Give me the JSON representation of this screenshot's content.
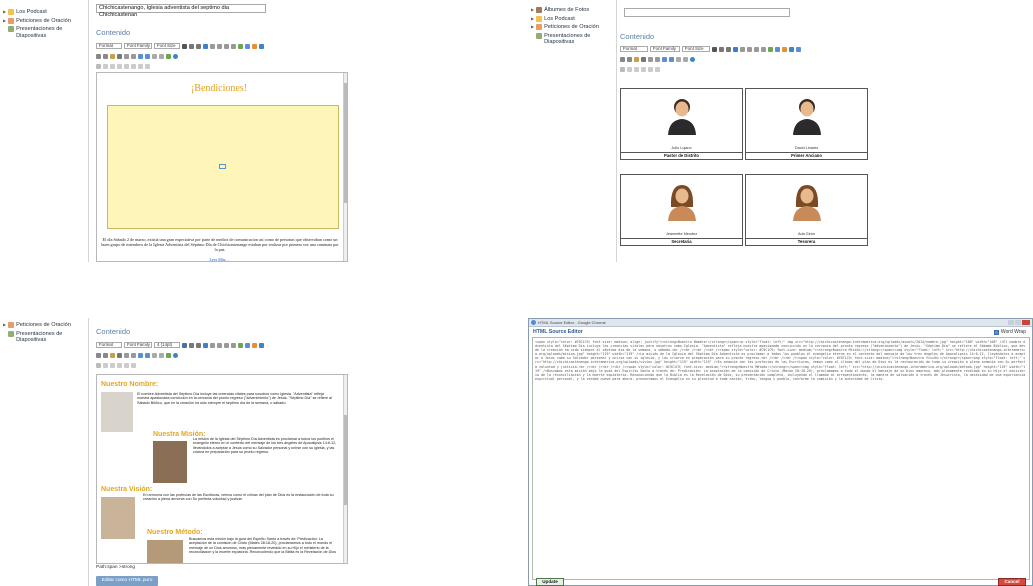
{
  "panel1": {
    "sidebar": [
      {
        "label": "Los Podcast",
        "icon": "podcast-icon"
      },
      {
        "label": "Peticiones de Oración",
        "icon": "prayer-icon"
      },
      {
        "label": "Presentaciones de Diapositivas",
        "icon": "slides-icon"
      }
    ],
    "title_value": "Chichicastenango, Iglesia adventista del septimo dia Chichicastenan",
    "section_label": "Contenido",
    "toolbar": {
      "format": "Format",
      "font_family": "Font Family",
      "font_size": "Font Size"
    },
    "heading": "¡Bendiciones!",
    "body_text": "El día Sabado 2 de marzo, existía una gran expectativa por parte de medios de comunicacion asi como de personas que observaban como un buen grupo de miembros de la Iglesia Adventista del Séptimo Día de Chichicastenango estaban por realizar por primera vez una caminata por la paz.",
    "read_more": "Leer Más..."
  },
  "panel2": {
    "sidebar": [
      {
        "label": "Álbumes de Fotos",
        "icon": "photo-album-icon"
      },
      {
        "label": "Los Podcast",
        "icon": "podcast-icon"
      },
      {
        "label": "Peticiones de Oración",
        "icon": "prayer-icon"
      },
      {
        "label": "Presentaciones de Diapositivas",
        "icon": "slides-icon"
      }
    ],
    "section_label": "Contenido",
    "toolbar": {
      "format": "Format",
      "font_family": "Font Family",
      "font_size": "Font Size"
    },
    "people": [
      {
        "name": "Julio Lujano",
        "role": "Pastor de Distrito",
        "gender": "male"
      },
      {
        "name": "David Linares",
        "role": "Primer Anciano",
        "gender": "male"
      },
      {
        "name": "Jeannette Méndez",
        "role": "Secretaria",
        "gender": "female"
      },
      {
        "name": "Ada Girón",
        "role": "Tesorera",
        "gender": "female"
      }
    ]
  },
  "panel3": {
    "sidebar": [
      {
        "label": "Peticiones de Oración",
        "icon": "prayer-icon"
      },
      {
        "label": "Presentaciones de Diapositivas",
        "icon": "slides-icon"
      }
    ],
    "section_label": "Contenido",
    "toolbar": {
      "format": "Format",
      "font_family": "Font Family",
      "font_size": "4 (14pt)"
    },
    "sections": [
      {
        "title": "Nuestro Nombre:",
        "text": "El nombre Adventista del Séptimo Día incluye las creencias vitales para nosotros como Iglesia. \"Adventista\" refleja nuestra apasionada convicción en la cercanía del pronto regreso (\"advenimiento\") de Jesús. \"Séptimo Día\" se refiere al Sábado Bíblico, que en la creación ha sido siempre el séptimo día de la semana, o sábado."
      },
      {
        "title": "Nuestra Misión:",
        "text": "La misión de la Iglesia del Séptimo Día Adventista es proclamar a todos los pueblos el evangelio eterno en el contexto del mensaje de los tres ángeles de Apocalipsis 14:6-12, llevándolos a aceptar a Jesús como su Salvador personal y unirse con su iglesia, y las criarza en preparación para su pronto regreso."
      },
      {
        "title": "Nuestra Visión:",
        "text": "En armonía con las profecías de las Escrituras, vemos como el clímax del plan de Dios es la restauración de toda su creación a plena armonía con Su perfecta voluntad y justicia."
      },
      {
        "title": "Nuestro Método:",
        "text": "Buscamos esta misión bajo la guía del Espíritu Santo a través de: Predicación: La aceptación de la comisión de Cristo (Mateo 28:18-20), proclamamos a todo el mundo el mensaje de un Dios amoroso, más plenamente revelado en su Hijo el ministerio de la reconciliación y la muerte expiatoria. Reconociendo que la Biblia es la Revelación de Dios"
      }
    ],
    "path": "Path:span >strong",
    "button": "Editar como HTML puro"
  },
  "panel4": {
    "window_title": "HTML Source Editor - Google Chrome",
    "dialog_title": "HTML Source Editor",
    "word_wrap": "Word Wrap",
    "code": "<span style=\"color: #C9C1C9; font-size: medium; align: justify\"><strong>Nuestro Nombre:</strong></span><p style=\"float: left;\" img src=\"http://chichicastenango.interamerica.org/uploads/assets/2014/nombre.jpg\" height=\"100\" width=\"108\" />El nombre Adventista del Séptimo Día incluye las creencias vitales para nosotros como Iglesia. \"Adventista\" refleja nuestra apasionada convicción en la cercanía del pronto regreso (\"advenimiento\") de Jesús. \"Séptimo Día\" se refiere al Sábado Bíblico, que desde la creación ha sido siempre el séptimo día de la semana, o sábado.<br /><br /><br /><br /><span style=\"color: #C9C1C9; font-size: medium;\"><strong>Nuestra Misión:</strong></span><img style=\"float: left;\" src=\"http://chichicastenango.interamerica.org/uploads/mision.jpg\" height=\"119\" width=\"119\" />La misión de la Iglesia del Séptimo Día Adventista es proclamar a todos los pueblos el evangelio eterno en el contexto del mensaje de los tres ángeles de Apocalipsis 14:6-12, llevándolos a aceptar a Jesús como su Salvador personal y unirse con su iglesia, y las criarza en preparación para su pronto regreso.<br /><br /><br /><span style=\"color: #C9C1C9; font-size: medium;\"><strong>Nuestra Visión:</strong></span><img style=\"float: left;\" src=\"http://chichicastenango.interamerica.org/uploads/vision.jpg\" height=\"119\" width=\"119\" />En armonía con las profecías de las Escrituras, vemos como el clímax del plan de Dios es la restauración de toda su creación a plena armonía con Su perfecta voluntad y justicia.<br /><br /><br /><br /><span style=\"color: #C9C1C9; font-size: medium;\"><strong>Nuestro Método:</strong></span><img style=\"float: left;\" src=\"http://chichicastenango.interamerica.org/uploads/metodo.jpg\" height=\"119\" width=\"119\" />Buscamos esta misión bajo la guía del Espíritu Santo a través de: Predicación: La aceptación de la comisión de Cristo (Mateo 28:18-20), proclamamos a todo el mundo el mensaje de un Dios amoroso, más plenamente revelado en su Hijo el ministerio de la reconciliación y la muerte expiatoria. Reconociendo que la Biblia es la Revelación de Dios, su presentación completa, incluyendo el llamado al arrepentimiento, la manera de salvación a través de Jesucristo, la necesidad de una experiencia espiritual personal, y la verdad nueva para ahora, presentamos el Evangelio en su plenitud a toda nación, tribu, lengua y pueblo, conforme la comisión y la autoridad de Cristo.",
    "update": "Update",
    "cancel": "Cancel"
  }
}
